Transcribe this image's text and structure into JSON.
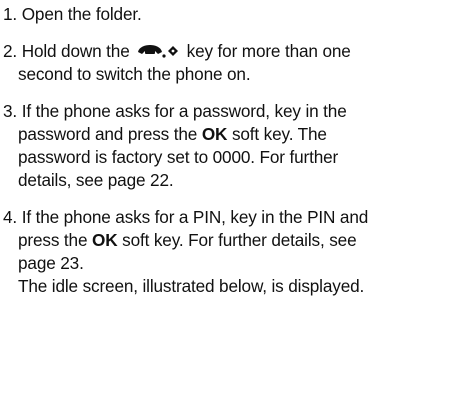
{
  "steps": [
    {
      "number": "1.",
      "text": "Open the folder."
    },
    {
      "number": "2.",
      "pre_icon": "Hold down the",
      "icon": "phone-power-key-icon",
      "post_icon": "key for more than one",
      "line2": "second to switch the phone on."
    },
    {
      "number": "3.",
      "line1": "If the phone asks for a password, key in the",
      "line2_pre": "password and press the",
      "line2_bold": "OK",
      "line2_post": "soft key. The",
      "line3": "password is factory set to 0000. For further",
      "line4": "details, see page 22."
    },
    {
      "number": "4.",
      "line1": "If the phone asks for a PIN, key in the PIN and",
      "line2_pre": "press the",
      "line2_bold": "OK",
      "line2_post": "soft key. For further details, see",
      "line3": "page 23.",
      "line4": "The idle screen, illustrated below, is displayed."
    }
  ]
}
